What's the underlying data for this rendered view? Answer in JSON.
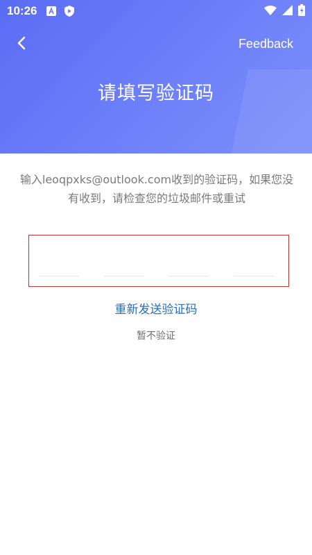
{
  "status_bar": {
    "time": "10:26",
    "icons": [
      "a-app-icon",
      "shield-play-icon",
      "wifi-icon",
      "signal-icon",
      "battery-charging-icon"
    ]
  },
  "header": {
    "back_icon": "chevron-left-icon",
    "feedback_label": "Feedback",
    "title": "请填写验证码",
    "background_color": "#6a7cf7"
  },
  "instruction": "输入leoqpxks@outlook.com收到的验证码，如果您没有收到，请检查您的垃圾邮件或重试",
  "code_input": {
    "digits": [
      "",
      "",
      "",
      ""
    ],
    "border_color": "#b03838"
  },
  "actions": {
    "resend_label": "重新发送验证码",
    "skip_label": "暂不验证",
    "link_color": "#2d6bb8"
  }
}
